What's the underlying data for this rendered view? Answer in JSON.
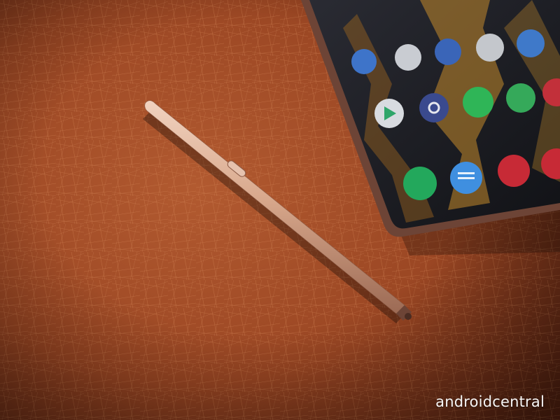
{
  "photo": {
    "subject": "stylus-next-to-smartphone-on-fabric",
    "colors": {
      "fabric": "#9e4a26",
      "fabric_dark": "#5a2411",
      "fabric_light": "#c26a3c",
      "stylus": "#dcae93",
      "phone_body": "#1a1a1f",
      "phone_frame": "#6d4436"
    },
    "apps": [
      {
        "icon": "arrow-app-icon",
        "color": "#3e74c9",
        "label": ""
      },
      {
        "icon": "chat-app-icon",
        "color": "#c9ccd2",
        "label": ""
      },
      {
        "icon": "blue-app-icon",
        "color": "#3a65b8",
        "label": ""
      },
      {
        "icon": "red-app-icon",
        "color": "#c4c7cc",
        "label": ""
      },
      {
        "icon": "bird-app-icon",
        "color": "#3f79c9",
        "label": ""
      },
      {
        "icon": "play-store-icon",
        "color": "#d8dbe0",
        "label": "Play Store"
      },
      {
        "icon": "settings-icon",
        "color": "#3a4a8e",
        "label": ""
      },
      {
        "icon": "whatsapp-icon",
        "color": "#2fb557",
        "label": ""
      },
      {
        "icon": "green-app-icon",
        "color": "#35a95a",
        "label": ""
      },
      {
        "icon": "red-app-icon-2",
        "color": "#c2303a",
        "label": ""
      },
      {
        "icon": "phone-icon",
        "color": "#23a85c",
        "label": ""
      },
      {
        "icon": "messages-icon",
        "color": "#3f8fe0",
        "label": ""
      },
      {
        "icon": "loop-app-icon",
        "color": "#c72a36",
        "label": ""
      },
      {
        "icon": "red-app-icon-3",
        "color": "#c72a36",
        "label": ""
      }
    ]
  },
  "watermark": {
    "text": "androidcentral"
  }
}
